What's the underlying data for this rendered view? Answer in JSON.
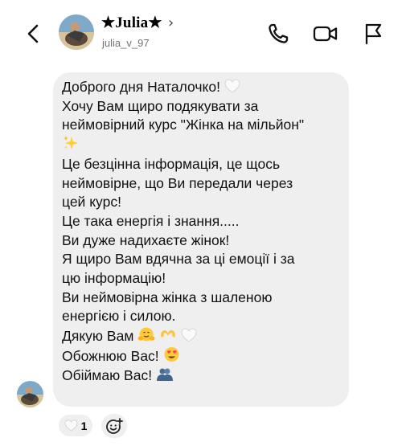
{
  "header": {
    "name": "★Julia★",
    "handle": "julia_v_97",
    "chevron": "›",
    "icons": [
      "back-arrow-icon",
      "phone-icon",
      "video-camera-icon",
      "flag-icon"
    ]
  },
  "message": {
    "lines": [
      "Доброго дня Наталочко!",
      "Хочу Вам щиро подякувати за",
      "неймовірний курс \"Жінка на мільйон\"",
      "",
      "Це безцінна інформація, це щось",
      "неймовірне, що Ви передали через",
      "цей курс!",
      "Це така енергія і знання.....",
      "Ви дуже надихаєте жінок!",
      "Я щиро Вам вдячна за ці емоції і за",
      "цю інформацію!",
      "Ви неймовірна жінка з шаленою",
      "енергією і силою.",
      "Дякую Вам",
      "Обожнюю Вас!",
      "Обіймаю Вас!"
    ],
    "emojis": [
      "white-heart",
      "sparkles",
      "hugging-face",
      "heart-hands",
      "white-heart",
      "heart-eyes-face",
      "people-hugging"
    ]
  },
  "reactions": {
    "count": "1",
    "emoji": "white-heart",
    "add_icon": "add-reaction-icon"
  },
  "colors": {
    "bubble": "#efefef",
    "handle": "#737373",
    "heart_eyes": "#ff3b5c",
    "face": "#ffc93a"
  }
}
